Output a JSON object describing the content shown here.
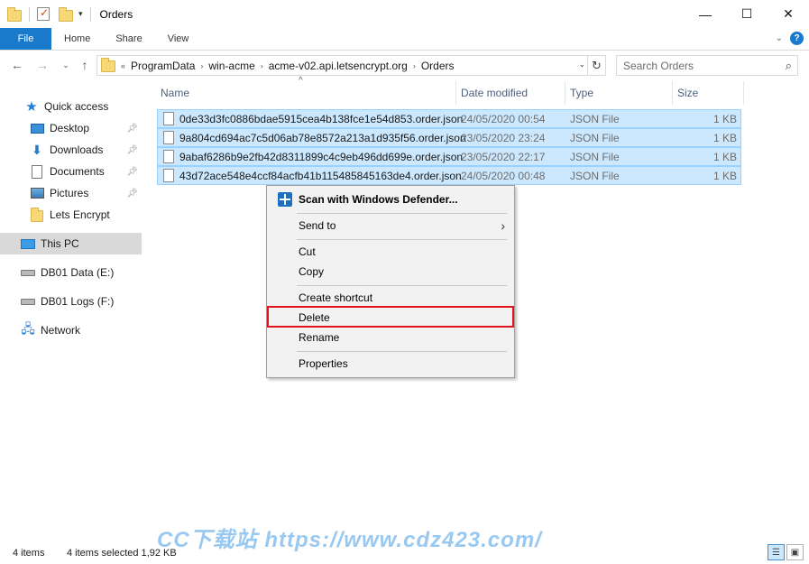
{
  "window": {
    "title": "Orders",
    "minimize": "—",
    "maximize": "☐",
    "close": "✕"
  },
  "ribbon": {
    "tabs": [
      "File",
      "Home",
      "Share",
      "View"
    ],
    "help": "?"
  },
  "address": {
    "prefix": "«",
    "segments": [
      "ProgramData",
      "win-acme",
      "acme-v02.api.letsencrypt.org",
      "Orders"
    ],
    "separator": "›"
  },
  "search": {
    "placeholder": "Search Orders"
  },
  "sidebar": {
    "items": [
      {
        "label": "Quick access",
        "icon": "star-icon"
      },
      {
        "label": "Desktop",
        "icon": "desktop-icon",
        "pinned": true
      },
      {
        "label": "Downloads",
        "icon": "downloads-icon",
        "pinned": true
      },
      {
        "label": "Documents",
        "icon": "documents-icon",
        "pinned": true
      },
      {
        "label": "Pictures",
        "icon": "pictures-icon",
        "pinned": true
      },
      {
        "label": "Lets Encrypt",
        "icon": "folder-icon"
      },
      {
        "label": "This PC",
        "icon": "this-pc-icon",
        "selected": true
      },
      {
        "label": "DB01 Data (E:)",
        "icon": "drive-icon"
      },
      {
        "label": "DB01 Logs (F:)",
        "icon": "drive-icon"
      },
      {
        "label": "Network",
        "icon": "network-icon"
      }
    ]
  },
  "columns": [
    "Name",
    "Date modified",
    "Type",
    "Size"
  ],
  "files": [
    {
      "name": "0de33d3fc0886bdae5915cea4b138fce1e54d853.order.json",
      "date": "24/05/2020 00:54",
      "type": "JSON File",
      "size": "1 KB"
    },
    {
      "name": "9a804cd694ac7c5d06ab78e8572a213a1d935f56.order.json",
      "date": "23/05/2020 23:24",
      "type": "JSON File",
      "size": "1 KB"
    },
    {
      "name": "9abaf6286b9e2fb42d8311899c4c9eb496dd699e.order.json",
      "date": "23/05/2020 22:17",
      "type": "JSON File",
      "size": "1 KB"
    },
    {
      "name": "43d72ace548e4ccf84acfb41b115485845163de4.order.json",
      "date": "24/05/2020 00:48",
      "type": "JSON File",
      "size": "1 KB"
    }
  ],
  "context_menu": {
    "scan": "Scan with Windows Defender...",
    "send_to": "Send to",
    "cut": "Cut",
    "copy": "Copy",
    "create_shortcut": "Create shortcut",
    "delete": "Delete",
    "rename": "Rename",
    "properties": "Properties",
    "highlight_color": "#e1141e"
  },
  "status": {
    "count": "4 items",
    "selection": "4 items selected  1,92 KB"
  },
  "watermark": "CC下载站 https://www.cdz423.com/",
  "colors": {
    "accent": "#1979ca",
    "selection": "#cce8ff"
  }
}
